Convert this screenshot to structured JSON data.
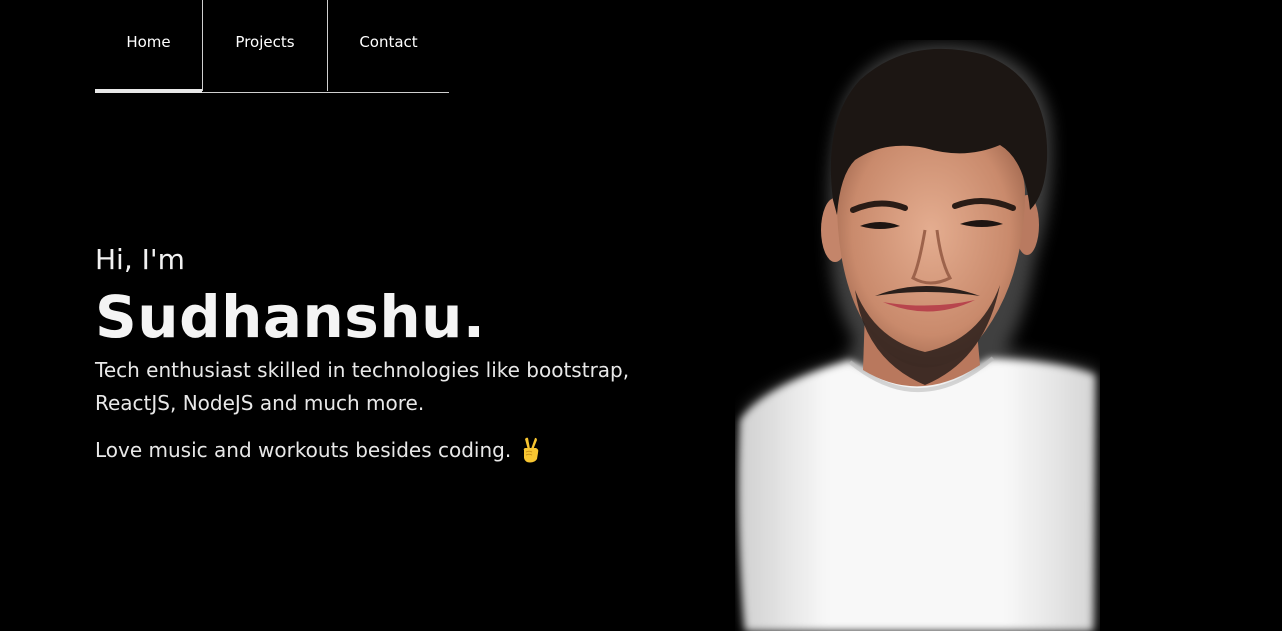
{
  "nav": {
    "tabs": [
      {
        "label": "Home",
        "active": true
      },
      {
        "label": "Projects",
        "active": false
      },
      {
        "label": "Contact",
        "active": false
      }
    ]
  },
  "hero": {
    "greeting": "Hi, I'm",
    "name": "Sudhanshu.",
    "description": "Tech enthusiast skilled in technologies like bootstrap, ReactJS, NodeJS and much more.",
    "hobby": "Love music and workouts besides coding.",
    "emoji_icon": "victory-hand-icon"
  },
  "colors": {
    "background": "#000000",
    "text": "#ffffff",
    "tab_underline": "#e8e8e8",
    "shirt": "#f6f6f6",
    "skin": "#d9a285",
    "hair": "#1a1412"
  }
}
